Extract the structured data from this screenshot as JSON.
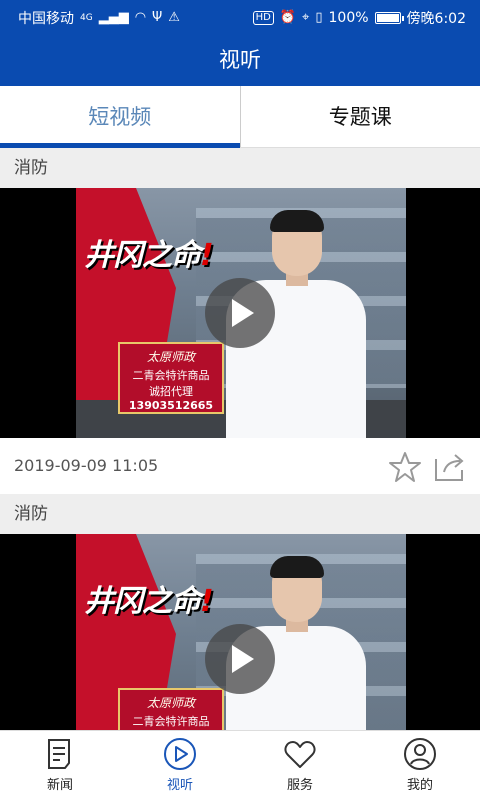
{
  "statusbar": {
    "carrier": "中国移动",
    "network": "4G",
    "battery": "100%",
    "battery_level": 1.0,
    "time": "傍晚6:02"
  },
  "header": {
    "title": "视听"
  },
  "tabs": [
    {
      "label": "短视频",
      "active": true
    },
    {
      "label": "专题课",
      "active": false
    }
  ],
  "feed": {
    "items": [
      {
        "category": "消防",
        "video": {
          "show_title": "井冈之命",
          "ad_lines": [
            "太原师政",
            "二青会特许商品",
            "诚招代理",
            "13903512665"
          ]
        },
        "date": "2019-09-09 11:05"
      },
      {
        "category": "消防",
        "video": {
          "show_title": "井冈之命",
          "ad_lines": [
            "太原师政",
            "二青会特许商品",
            "",
            ""
          ]
        }
      }
    ]
  },
  "bottomnav": {
    "items": [
      {
        "label": "新闻",
        "icon": "news-icon"
      },
      {
        "label": "视听",
        "icon": "play-circle-icon",
        "active": true
      },
      {
        "label": "服务",
        "icon": "heart-icon"
      },
      {
        "label": "我的",
        "icon": "profile-icon"
      }
    ]
  },
  "colors": {
    "brand": "#0a4bb0",
    "tab_active_text": "#5a87b8",
    "nav_active": "#1a56b8"
  }
}
